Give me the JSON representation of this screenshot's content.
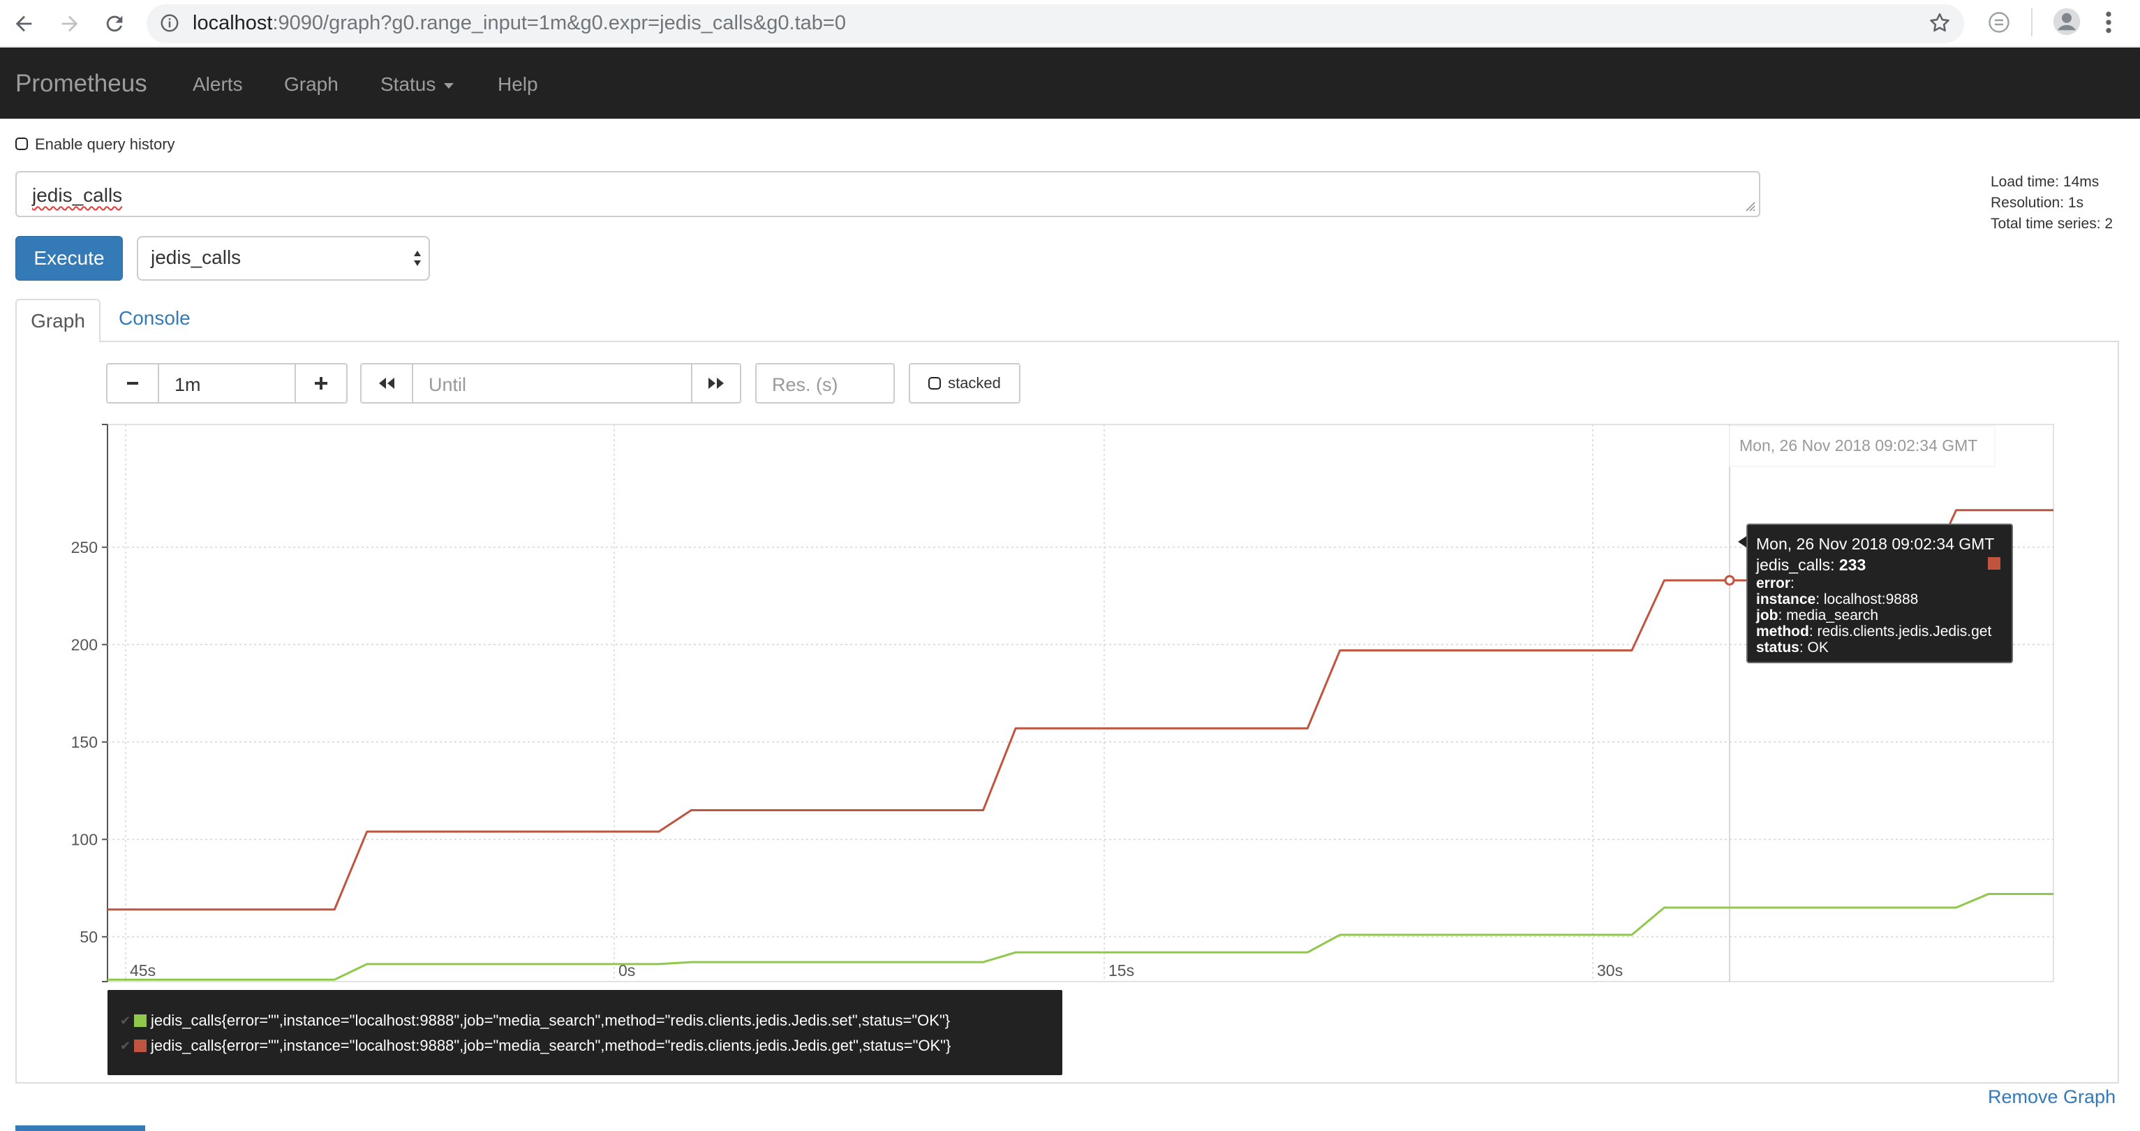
{
  "browser": {
    "url_host": "localhost",
    "url_rest": ":9090/graph?g0.range_input=1m&g0.expr=jedis_calls&g0.tab=0"
  },
  "navbar": {
    "brand": "Prometheus",
    "items": [
      {
        "label": "Alerts"
      },
      {
        "label": "Graph"
      },
      {
        "label": "Status"
      },
      {
        "label": "Help"
      }
    ]
  },
  "query": {
    "history_label": "Enable query history",
    "expression": "jedis_calls",
    "execute_label": "Execute",
    "metric_select": "jedis_calls",
    "stats": {
      "load_time": "Load time: 14ms",
      "resolution": "Resolution: 1s",
      "total_series": "Total time series: 2"
    }
  },
  "tabs": {
    "graph": "Graph",
    "console": "Console"
  },
  "controls": {
    "range": "1m",
    "until_placeholder": "Until",
    "res_placeholder": "Res. (s)",
    "stacked": "stacked"
  },
  "hover_label": "Mon, 26 Nov 2018 09:02:34 GMT",
  "tooltip": {
    "time": "Mon, 26 Nov 2018 09:02:34 GMT",
    "metric": "jedis_calls: ",
    "value": "233",
    "rows": [
      {
        "key": "error",
        "val": ""
      },
      {
        "key": "instance",
        "val": " localhost:9888"
      },
      {
        "key": "job",
        "val": " media_search"
      },
      {
        "key": "method",
        "val": " redis.clients.jedis.Jedis.get"
      },
      {
        "key": "status",
        "val": " OK"
      }
    ],
    "swatch_color": "#c0543e"
  },
  "legend": [
    {
      "label": "jedis_calls{error=\"\",instance=\"localhost:9888\",job=\"media_search\",method=\"redis.clients.jedis.Jedis.set\",status=\"OK\"}",
      "color": "#8fc84a"
    },
    {
      "label": "jedis_calls{error=\"\",instance=\"localhost:9888\",job=\"media_search\",method=\"redis.clients.jedis.Jedis.get\",status=\"OK\"}",
      "color": "#c0543e"
    }
  ],
  "remove_label": "Remove Graph",
  "chart_data": {
    "type": "line",
    "x_ticks": [
      "45s",
      "0s",
      "15s",
      "30s"
    ],
    "y_ticks": [
      50,
      100,
      150,
      200,
      250
    ],
    "ylim": [
      27,
      313
    ],
    "grid": true,
    "series": [
      {
        "name": "jedis_calls{error=\"\",instance=\"localhost:9888\",job=\"media_search\",method=\"redis.clients.jedis.Jedis.set\",status=\"OK\"}",
        "color": "#8fc84a",
        "points": [
          [
            -47,
            28
          ],
          [
            -40,
            28
          ],
          [
            -39,
            36
          ],
          [
            -30,
            36
          ],
          [
            -29,
            37
          ],
          [
            -20,
            37
          ],
          [
            -19,
            42
          ],
          [
            -10,
            42
          ],
          [
            -9,
            51
          ],
          [
            0,
            51
          ],
          [
            1,
            65
          ],
          [
            10,
            65
          ],
          [
            11,
            72
          ],
          [
            13,
            72
          ]
        ]
      },
      {
        "name": "jedis_calls{error=\"\",instance=\"localhost:9888\",job=\"media_search\",method=\"redis.clients.jedis.Jedis.get\",status=\"OK\"}",
        "color": "#c0543e",
        "points": [
          [
            -47,
            64
          ],
          [
            -40,
            64
          ],
          [
            -39,
            104
          ],
          [
            -30,
            104
          ],
          [
            -29,
            115
          ],
          [
            -20,
            115
          ],
          [
            -19,
            157
          ],
          [
            -10,
            157
          ],
          [
            -9,
            197
          ],
          [
            0,
            197
          ],
          [
            1,
            233
          ],
          [
            9,
            233
          ],
          [
            10,
            269
          ],
          [
            13,
            269
          ]
        ]
      }
    ],
    "hover_x": 3,
    "hover_value": 233
  }
}
